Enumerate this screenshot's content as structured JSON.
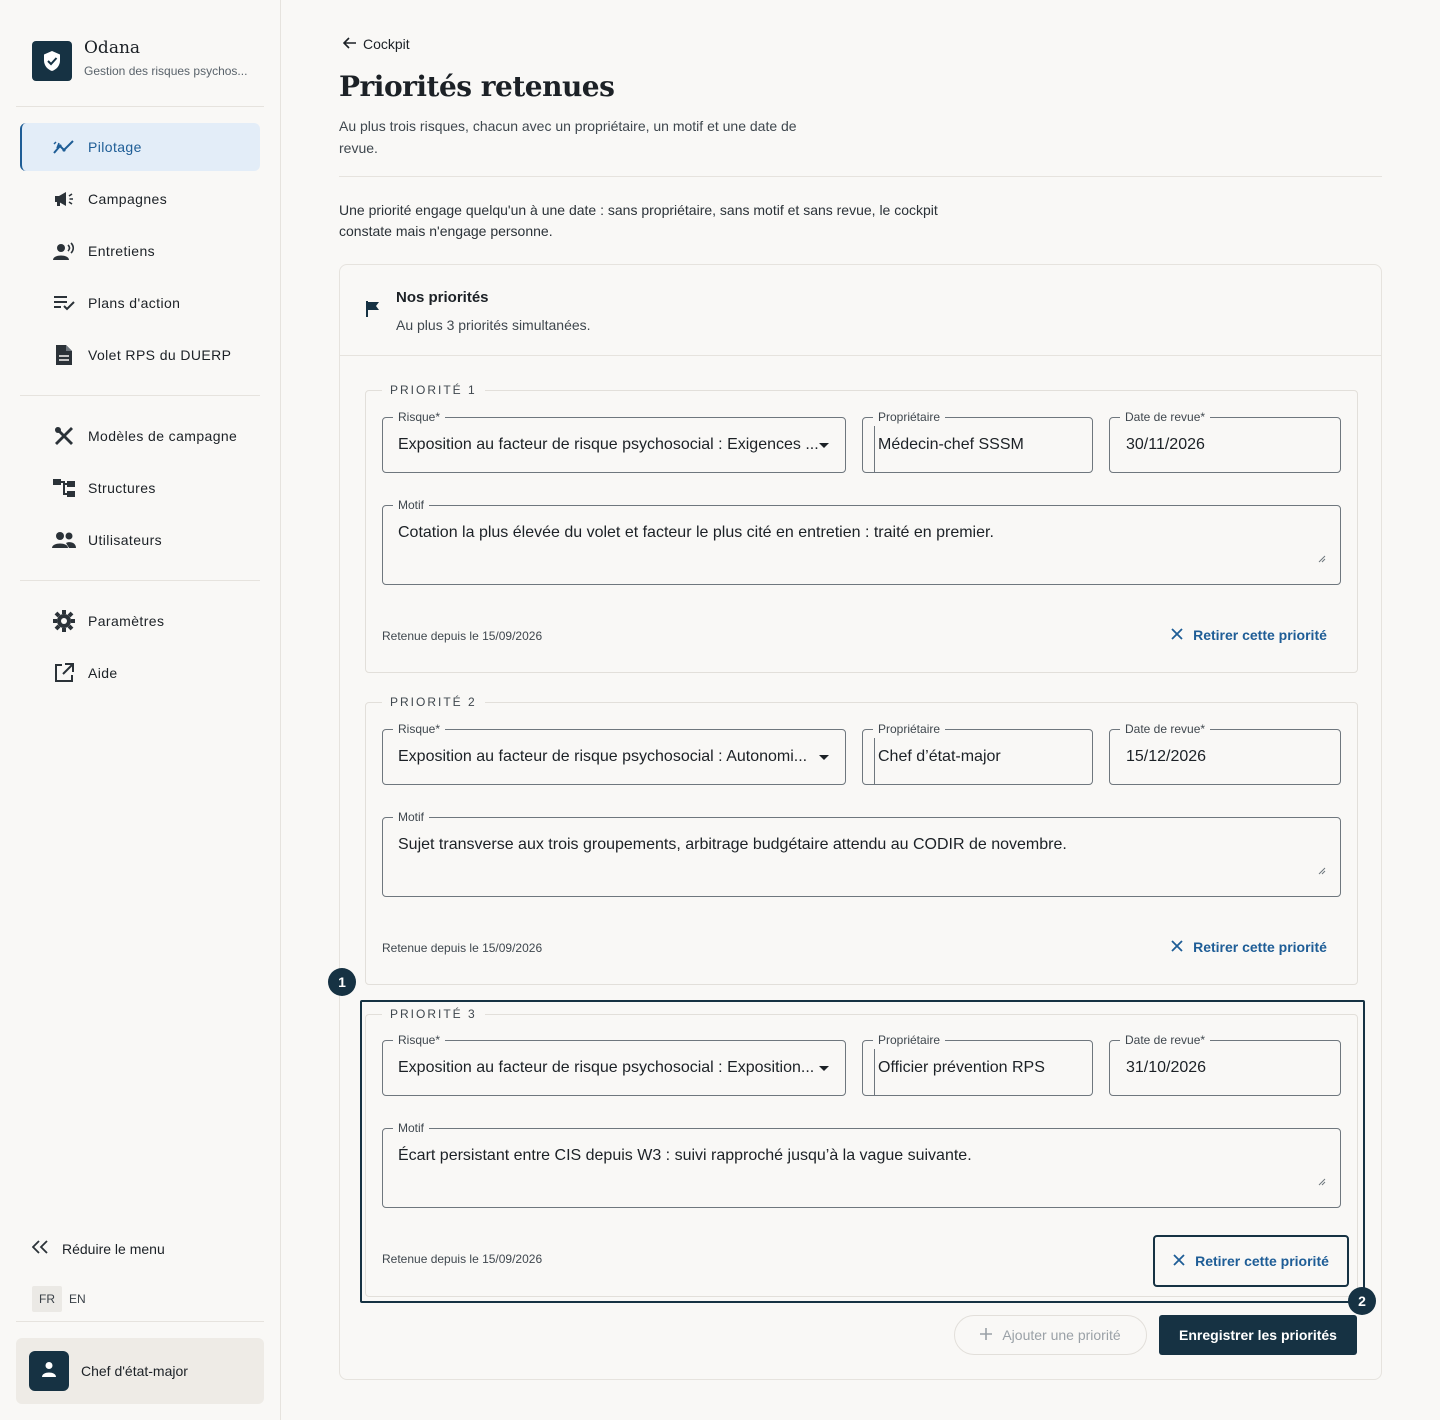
{
  "app": {
    "name": "Odana",
    "subtitle": "Gestion des risques psychos..."
  },
  "nav": {
    "primary": [
      {
        "label": "Pilotage",
        "icon": "chart-line-icon",
        "active": true
      },
      {
        "label": "Campagnes",
        "icon": "megaphone-icon"
      },
      {
        "label": "Entretiens",
        "icon": "person-voice-icon"
      },
      {
        "label": "Plans d'action",
        "icon": "list-check-icon"
      },
      {
        "label": "Volet RPS du DUERP",
        "icon": "document-icon"
      }
    ],
    "secondary": [
      {
        "label": "Modèles de campagne",
        "icon": "tools-icon"
      },
      {
        "label": "Structures",
        "icon": "hierarchy-icon"
      },
      {
        "label": "Utilisateurs",
        "icon": "users-icon"
      }
    ],
    "tertiary": [
      {
        "label": "Paramètres",
        "icon": "gear-icon"
      },
      {
        "label": "Aide",
        "icon": "external-link-icon"
      }
    ],
    "reduce_label": "Réduire le menu",
    "languages": [
      "FR",
      "EN"
    ],
    "user_name": "Chef d'état-major"
  },
  "page": {
    "back_label": "Cockpit",
    "title": "Priorités retenues",
    "subtitle": "Au plus trois risques, chacun avec un propriétaire, un motif et une date de revue.",
    "intro": "Une priorité engage quelqu'un à une date : sans propriétaire, sans motif et sans revue, le cockpit constate mais n'engage personne."
  },
  "card": {
    "title": "Nos priorités",
    "subtitle": "Au plus 3 priorités simultanées.",
    "labels": {
      "risk": "Risque*",
      "owner": "Propriétaire",
      "review": "Date de revue*",
      "reason": "Motif",
      "remove": "Retirer cette priorité"
    },
    "priorities": [
      {
        "legend": "PRIORITÉ 1",
        "risk": "Exposition au facteur de risque psychosocial : Exigences ...",
        "owner": "Médecin-chef SSSM",
        "review_date": "30/11/2026",
        "reason": "Cotation la plus élevée du volet et facteur le plus cité en entretien : traité en premier.",
        "since": "Retenue depuis le 15/09/2026"
      },
      {
        "legend": "PRIORITÉ 2",
        "risk": "Exposition au facteur de risque psychosocial : Autonomi...",
        "owner": "Chef d’état-major",
        "review_date": "15/12/2026",
        "reason": "Sujet transverse aux trois groupements, arbitrage budgétaire attendu au CODIR de novembre.",
        "since": "Retenue depuis le 15/09/2026"
      },
      {
        "legend": "PRIORITÉ 3",
        "risk": "Exposition au facteur de risque psychosocial : Exposition...",
        "owner": "Officier prévention RPS",
        "review_date": "31/10/2026",
        "reason": "Écart persistant entre CIS depuis W3 : suivi rapproché jusqu’à la vague suivante.",
        "since": "Retenue depuis le 15/09/2026"
      }
    ],
    "add_label": "Ajouter une priorité",
    "save_label": "Enregistrer les priorités"
  },
  "annotations": [
    "1",
    "2"
  ],
  "colors": {
    "brand": "#163243",
    "accent": "#1e5d96",
    "active_bg": "#e3edf8"
  }
}
